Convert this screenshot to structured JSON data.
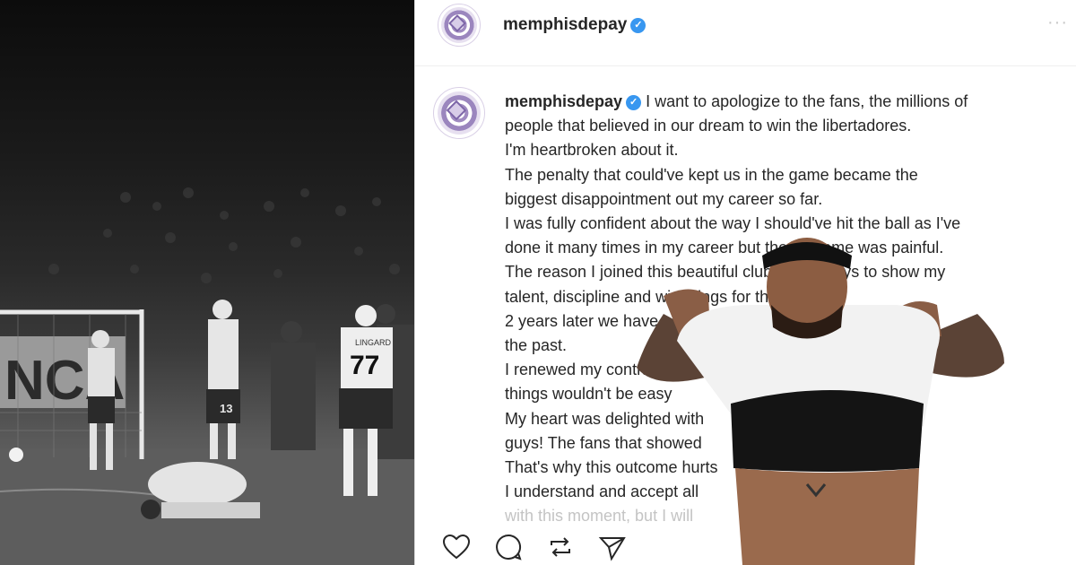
{
  "post": {
    "username": "memphisdepay",
    "verified_badge": "✓",
    "more_label": "···",
    "caption": {
      "username": "memphisdepay",
      "lines": [
        {
          "dark": "I want to apologize to the fans, the millions of",
          "light": ""
        },
        {
          "dark": "people that believed in our dream to win the libertadores.",
          "light": ""
        },
        {
          "dark": "I'm heartbroken about it.",
          "light": ""
        },
        {
          "dark": "The penalty that could've kept us in the game became the",
          "light": ""
        },
        {
          "dark": "biggest disappointment out my career so far.",
          "light": ""
        },
        {
          "dark": "I was fully confident about the way I should've hit the ball as I've",
          "light": ""
        },
        {
          "dark": "done it many times in my career but the outcome was painful.",
          "light": ""
        },
        {
          "dark": "The reason I joined this beautiful club was always to show my",
          "light": ""
        },
        {
          "dark": "talent, discipline and win things for this club.",
          "light": ""
        },
        {
          "dark": "2 years later we have accomplished what was not done in",
          "light": ""
        },
        {
          "dark": "the past.",
          "light": ""
        },
        {
          "dark": "I renewed my contract",
          "light": ""
        },
        {
          "dark": "things wouldn't be easy",
          "light": ""
        },
        {
          "dark": "My heart was delighted with",
          "light": ""
        },
        {
          "dark": "guys! The fans that showed",
          "light": ""
        },
        {
          "dark": "That's why this outcome hurts",
          "light": ""
        },
        {
          "dark": "I understand and accept all",
          "light": ""
        },
        {
          "dark": "with this moment, but I will",
          "light": ""
        }
      ]
    },
    "actions": [
      "heart-icon",
      "comment-icon",
      "repost-icon",
      "share-icon"
    ]
  },
  "photo": {
    "jersey_number": "77",
    "jersey_name": "LINGARD",
    "shorts_number": "13",
    "banner_text": "NCA"
  },
  "colors": {
    "verified": "#3897f0",
    "text": "#262626",
    "faded_text": "#c4c4c4",
    "avatar_purple": "#9b86be"
  }
}
